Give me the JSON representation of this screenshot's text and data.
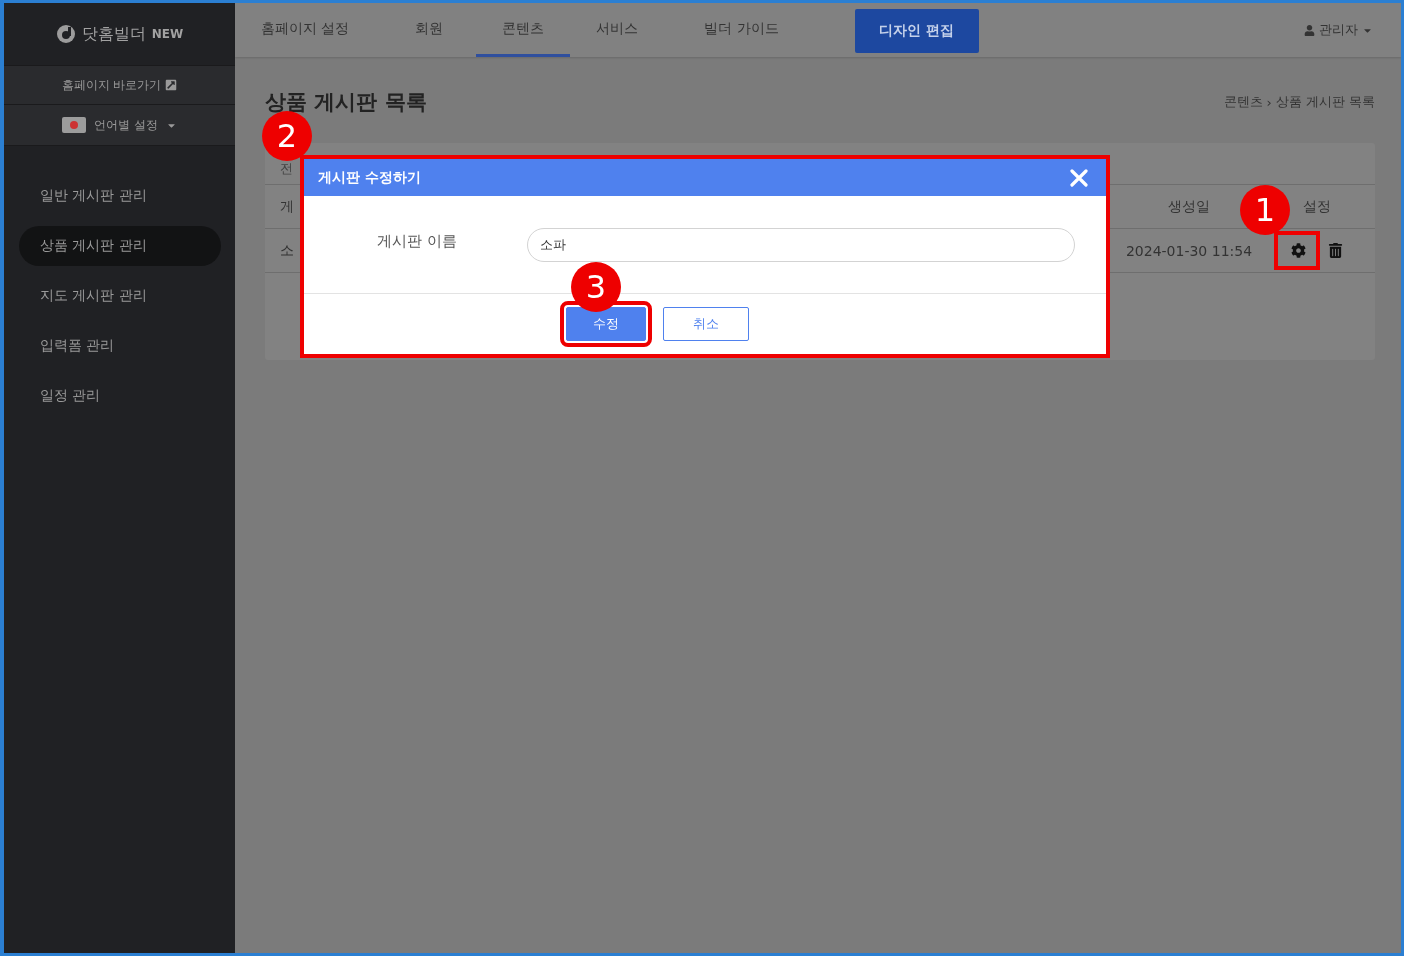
{
  "brand": {
    "name": "닷홈빌더",
    "badge": "NEW"
  },
  "sidebar": {
    "homepage_link": "홈페이지 바로가기",
    "language": "언어별 설정",
    "items": [
      {
        "label": "일반 게시판 관리",
        "selected": false
      },
      {
        "label": "상품 게시판 관리",
        "selected": true
      },
      {
        "label": "지도 게시판 관리",
        "selected": false
      },
      {
        "label": "입력폼 관리",
        "selected": false
      },
      {
        "label": "일정 관리",
        "selected": false
      }
    ]
  },
  "top_nav": {
    "tabs": [
      {
        "label": "홈페이지 설정",
        "selected": false
      },
      {
        "label": "회원",
        "selected": false
      },
      {
        "label": "콘텐츠",
        "selected": true
      },
      {
        "label": "서비스",
        "selected": false
      },
      {
        "label": "빌더 가이드",
        "selected": false
      }
    ],
    "design_button": "디자인 편집",
    "user": "관리자"
  },
  "page": {
    "title": "상품 게시판 목록",
    "breadcrumb": [
      "콘텐츠",
      "상품 게시판 목록"
    ],
    "breadcrumb_separator": "›"
  },
  "table": {
    "summary": "전",
    "columns": [
      "게",
      "생성일",
      "설정"
    ],
    "rows": [
      {
        "name": "소",
        "created": "2024-01-30 11:54"
      }
    ]
  },
  "dialog": {
    "title": "게시판 수정하기",
    "field_label": "게시판 이름",
    "field_value": "소파",
    "buttons": [
      {
        "label": "수정",
        "kind": "primary"
      },
      {
        "label": "취소",
        "kind": "secondary"
      }
    ]
  },
  "annotations": [
    {
      "number": "1"
    },
    {
      "number": "2"
    },
    {
      "number": "3"
    }
  ]
}
